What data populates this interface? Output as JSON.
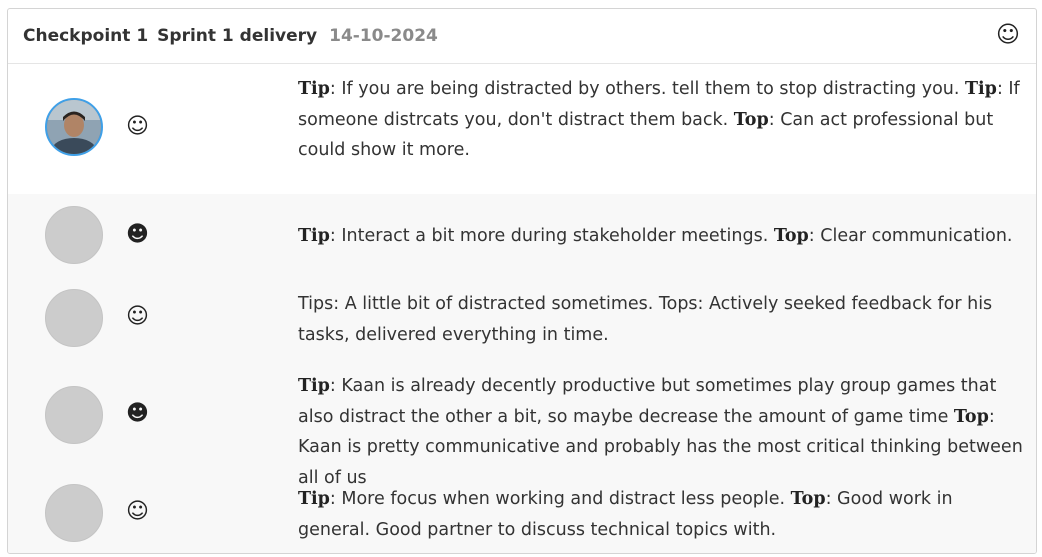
{
  "header": {
    "title": "Checkpoint 1",
    "subtitle": "Sprint 1 delivery",
    "date": "14-10-2024",
    "icon": "smiley-icon"
  },
  "feedback": [
    {
      "avatar": "user-photo",
      "mood_icon": "slight-smile-icon",
      "mood_glyph": "☺",
      "parts": [
        {
          "kw": "Tip",
          "text": ": If you are being distracted by others. tell them to stop distracting you. "
        },
        {
          "kw": "Tip",
          "text": ": If someone distrcats you, don't distract them back. "
        },
        {
          "kw": "Top",
          "text": ": Can act professional but could show it more."
        }
      ]
    },
    {
      "avatar": "placeholder",
      "mood_icon": "grin-icon",
      "mood_glyph": "☻",
      "parts": [
        {
          "kw": "Tip",
          "text": ": Interact a bit more during stakeholder meetings. "
        },
        {
          "kw": "Top",
          "text": ": Clear communication."
        }
      ]
    },
    {
      "avatar": "placeholder",
      "mood_icon": "slight-smile-icon",
      "mood_glyph": "☺",
      "parts": [
        {
          "kw": "",
          "text": "Tips: A little bit of distracted sometimes. Tops: Actively seeked feedback for his tasks, delivered everything in time."
        }
      ]
    },
    {
      "avatar": "placeholder",
      "mood_icon": "grin-icon",
      "mood_glyph": "☻",
      "parts": [
        {
          "kw": "Tip",
          "text": ": Kaan is already decently productive but sometimes play group games that also distract the other a bit, so maybe decrease the amount of game time "
        },
        {
          "kw": "Top",
          "text": ": Kaan is pretty communicative and probably has the most critical thinking between all of us"
        }
      ]
    },
    {
      "avatar": "placeholder",
      "mood_icon": "slight-smile-icon",
      "mood_glyph": "☺",
      "parts": [
        {
          "kw": "Tip",
          "text": ": More focus when working and distract less people. "
        },
        {
          "kw": "Top",
          "text": ": Good work in general. Good partner to discuss technical topics with."
        }
      ]
    }
  ]
}
